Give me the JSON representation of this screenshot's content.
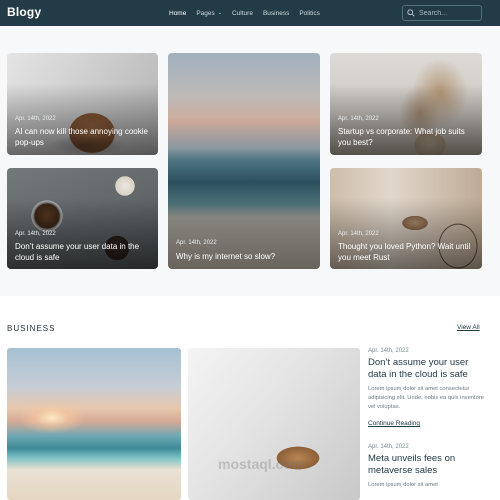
{
  "brand": "Blogy",
  "nav": {
    "items": [
      {
        "label": "Home",
        "active": true
      },
      {
        "label": "Pages",
        "dropdown": true,
        "caret": "⌄"
      },
      {
        "label": "Culture"
      },
      {
        "label": "Business"
      },
      {
        "label": "Politics"
      }
    ]
  },
  "search": {
    "placeholder": "Search...",
    "icon": "search-icon"
  },
  "hero_cards": [
    {
      "date": "Apr. 14th, 2022",
      "title": "AI can now kill those annoying cookie pop-ups"
    },
    {
      "date": "Apr. 14th, 2022",
      "title": "Why is my internet so slow?"
    },
    {
      "date": "Apr. 14th, 2022",
      "title": "Startup vs corporate: What job suits you best?"
    },
    {
      "date": "Apr. 14th, 2022",
      "title": "Don’t assume your user data in the cloud is safe"
    },
    {
      "date": "Apr. 14th, 2022",
      "title": "Thought you loved Python? Wait until you meet Rust"
    }
  ],
  "business": {
    "title": "BUSINESS",
    "view_all": "View All",
    "posts": [
      {
        "date": "Apr. 14th, 2022",
        "title": "Don’t assume your user data in the cloud is safe",
        "excerpt": "Lorem ipsum dolor sit amet consectetur adipisicing elit. Unde, nobis ea quis inventore vel voluptas.",
        "link": "Continue Reading"
      },
      {
        "date": "Apr. 14th, 2022",
        "title": "Meta unveils fees on metaverse sales",
        "excerpt": "Lorem ipsum dolor sit amet"
      }
    ]
  },
  "watermark": "mostaql.com"
}
